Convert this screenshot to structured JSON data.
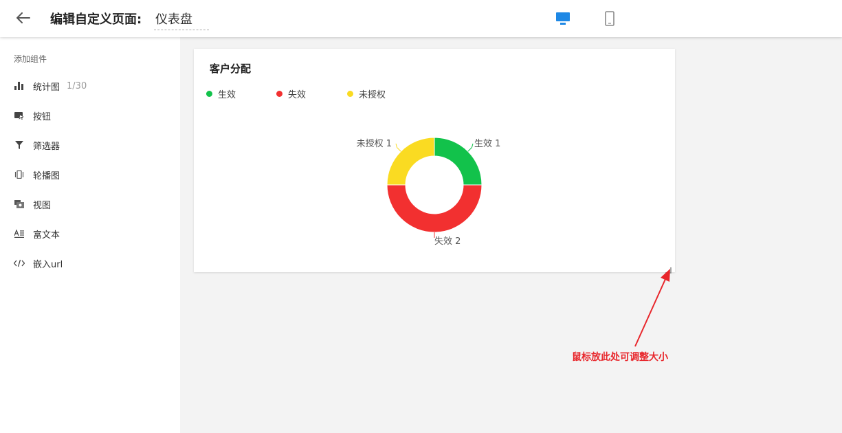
{
  "header": {
    "title": "编辑自定义页面:",
    "page_name": "仪表盘",
    "active_device": "desktop",
    "accent_color": "#1e88e5"
  },
  "sidebar": {
    "heading": "添加组件",
    "items": [
      {
        "label": "统计图",
        "count": "1/30",
        "icon": "bar-chart-icon"
      },
      {
        "label": "按钮",
        "icon": "button-icon"
      },
      {
        "label": "筛选器",
        "icon": "filter-icon"
      },
      {
        "label": "轮播图",
        "icon": "carousel-icon"
      },
      {
        "label": "视图",
        "icon": "view-icon"
      },
      {
        "label": "富文本",
        "icon": "rich-text-icon"
      },
      {
        "label": "嵌入url",
        "icon": "embed-code-icon"
      }
    ]
  },
  "widget": {
    "title": "客户分配",
    "chart_data": {
      "type": "pie",
      "categories": [
        "生效",
        "失效",
        "未授权"
      ],
      "values": [
        1,
        2,
        1
      ],
      "colors": [
        "#12c24b",
        "#f23030",
        "#fadb22"
      ],
      "slice_labels": [
        "生效  1",
        "失效  2",
        "未授权  1"
      ],
      "legend_position": "top-left"
    }
  },
  "annotation": {
    "text": "鼠标放此处可调整大小",
    "color": "#e8262b"
  }
}
